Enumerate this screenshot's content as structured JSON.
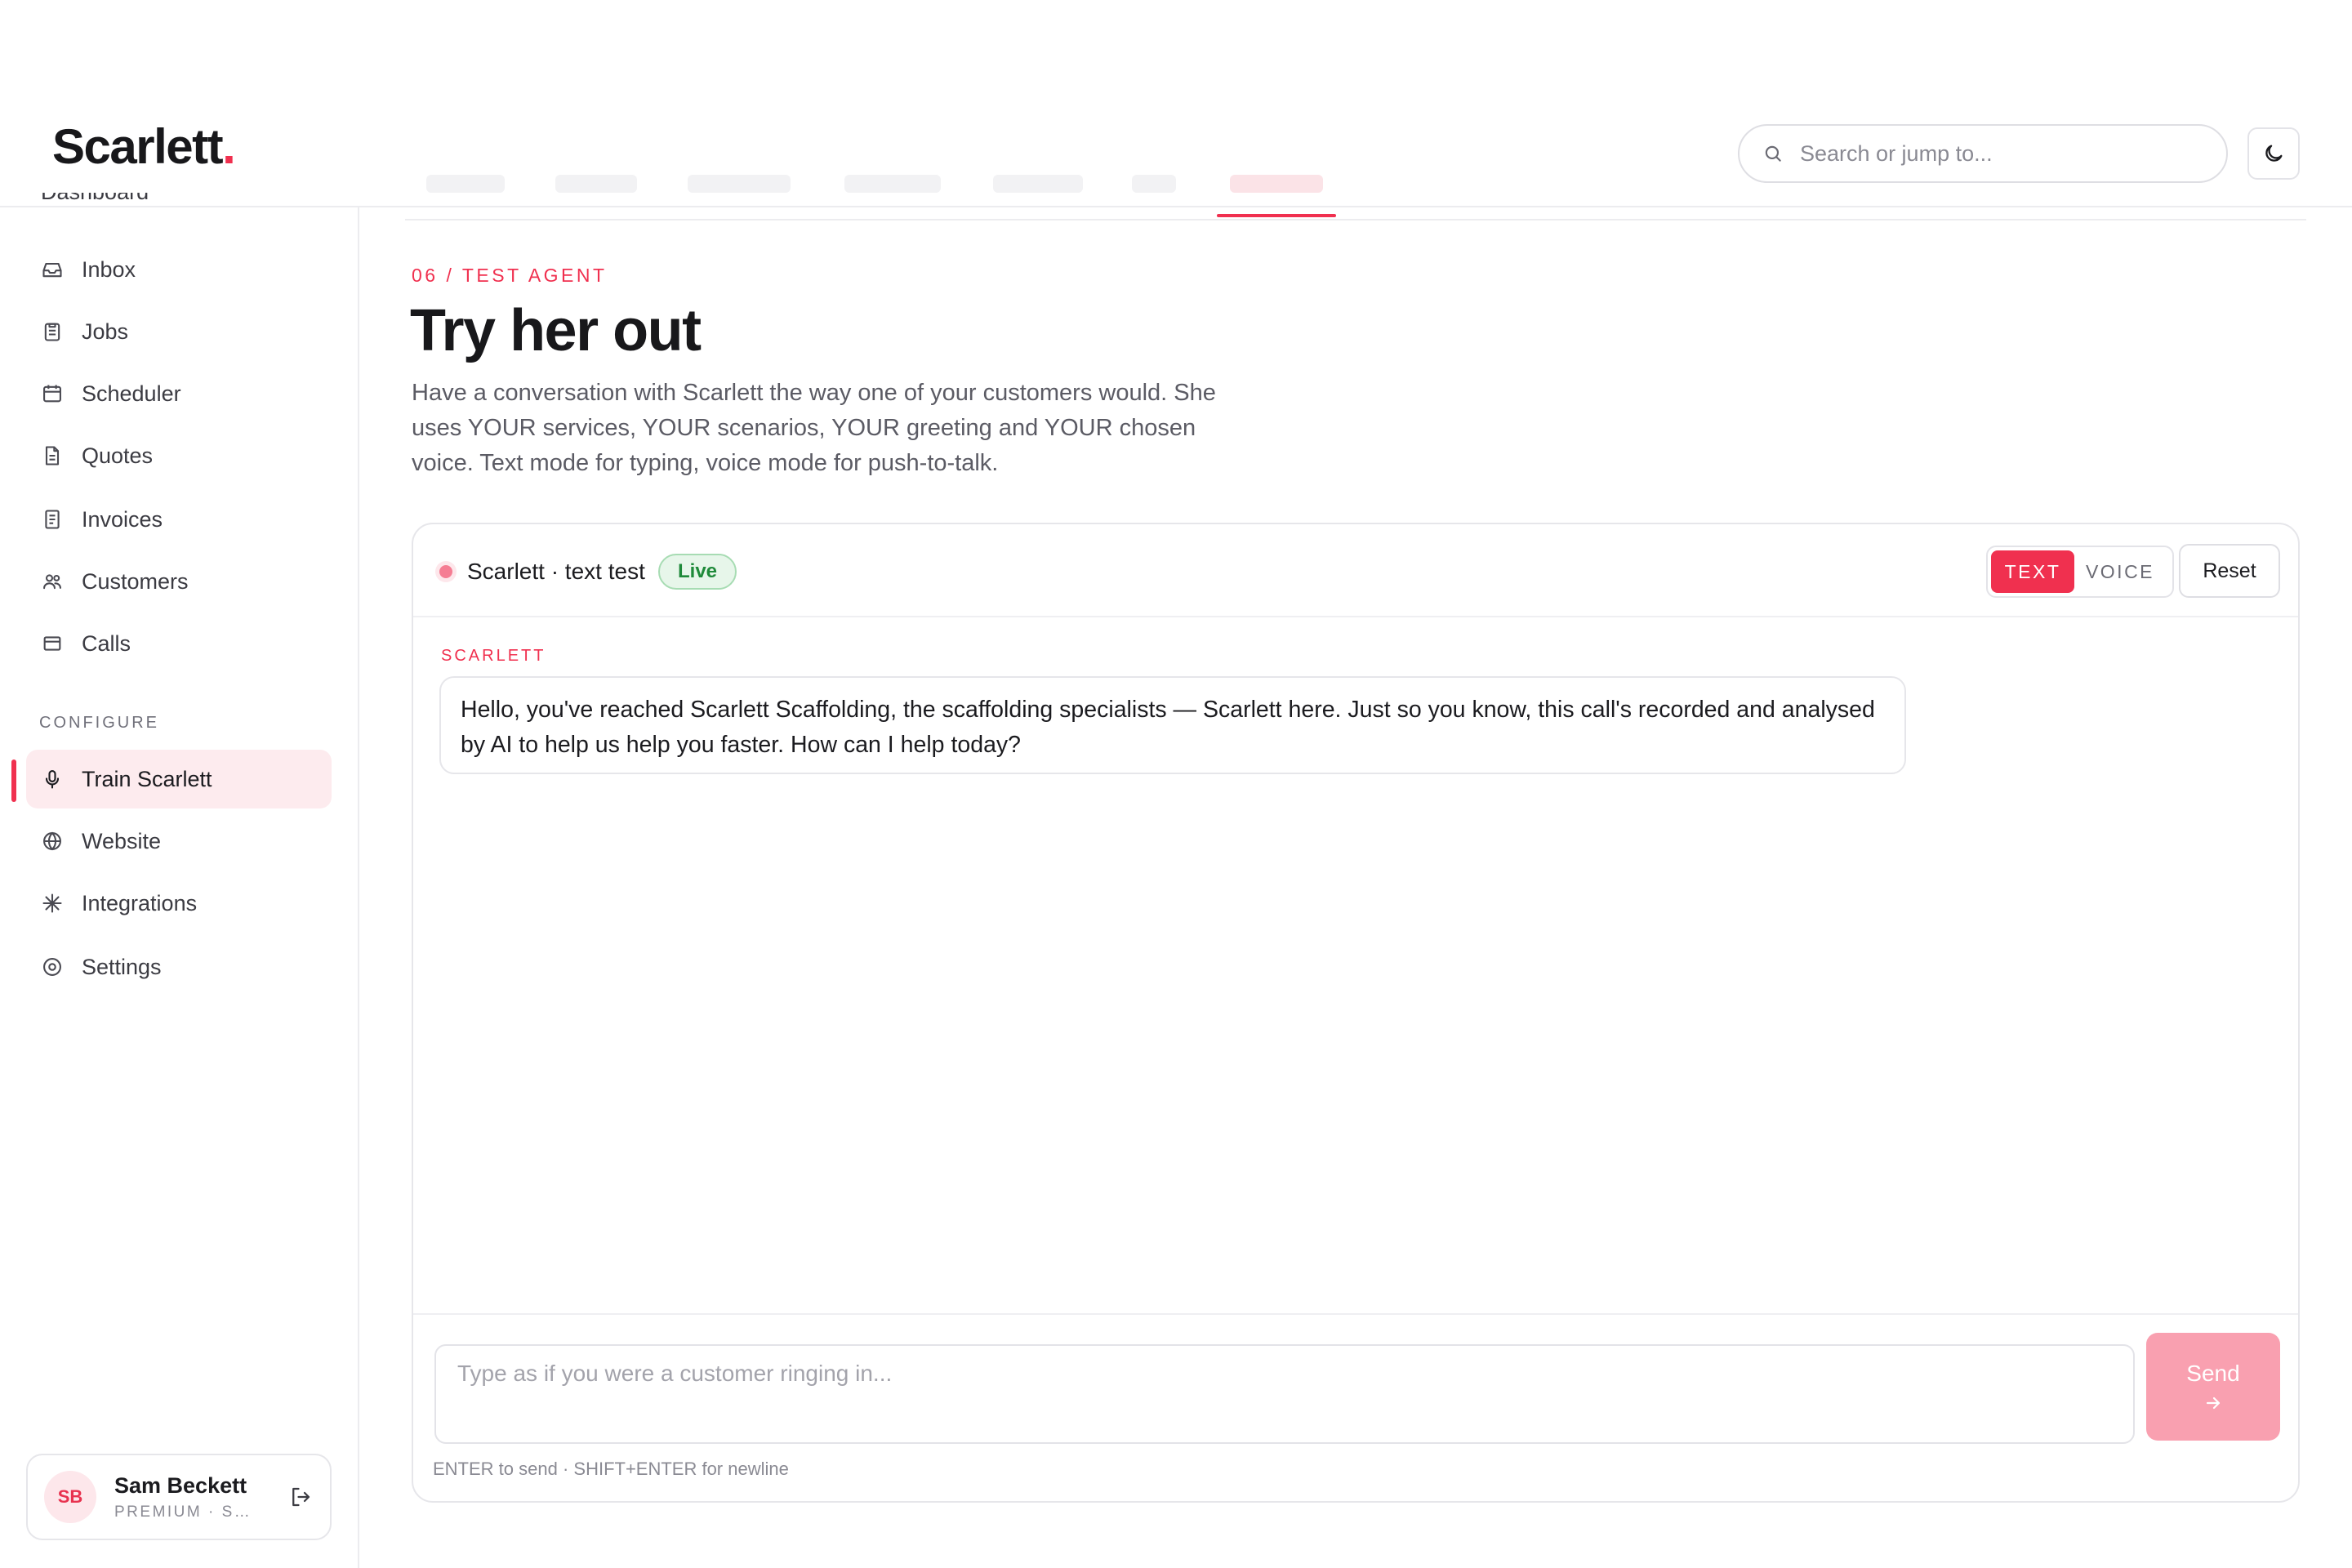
{
  "brand": {
    "name": "Scarlett",
    "dot": "."
  },
  "header": {
    "search_placeholder": "Search or jump to..."
  },
  "sidebar": {
    "partial_item": "Dashboard",
    "items": [
      {
        "label": "Inbox",
        "icon": "inbox-icon"
      },
      {
        "label": "Jobs",
        "icon": "clipboard-icon"
      },
      {
        "label": "Scheduler",
        "icon": "calendar-icon"
      },
      {
        "label": "Quotes",
        "icon": "document-icon"
      },
      {
        "label": "Invoices",
        "icon": "receipt-icon"
      },
      {
        "label": "Customers",
        "icon": "users-icon"
      },
      {
        "label": "Calls",
        "icon": "card-icon"
      }
    ],
    "section_label": "CONFIGURE",
    "config_items": [
      {
        "label": "Train Scarlett",
        "icon": "microphone-icon",
        "active": true
      },
      {
        "label": "Website",
        "icon": "globe-icon"
      },
      {
        "label": "Integrations",
        "icon": "sparkle-icon"
      },
      {
        "label": "Settings",
        "icon": "settings-icon"
      }
    ],
    "user": {
      "initials": "SB",
      "name": "Sam Beckett",
      "plan": "PREMIUM · S..."
    }
  },
  "main": {
    "eyebrow": "06 / TEST AGENT",
    "title": "Try her out",
    "description": "Have a conversation with Scarlett the way one of your customers would. She uses YOUR services, YOUR scenarios, YOUR greeting and YOUR chosen voice. Text mode for typing, voice mode for push-to-talk.",
    "chat": {
      "session_title": "Scarlett · text test",
      "status_badge": "Live",
      "mode_text": "TEXT",
      "mode_voice": "VOICE",
      "reset_label": "Reset",
      "sender_label": "SCARLETT",
      "message": "Hello, you've reached Scarlett Scaffolding, the scaffolding specialists — Scarlett here. Just so you know, this call's recorded and analysed by AI to help us help you faster. How can I help today?",
      "input_placeholder": "Type as if you were a customer ringing in...",
      "send_label": "Send",
      "hint": "ENTER to send · SHIFT+ENTER for newline"
    }
  },
  "colors": {
    "accent": "#f0304f",
    "live_green": "#1f8a3a",
    "send_disabled": "#f9a0b0"
  }
}
